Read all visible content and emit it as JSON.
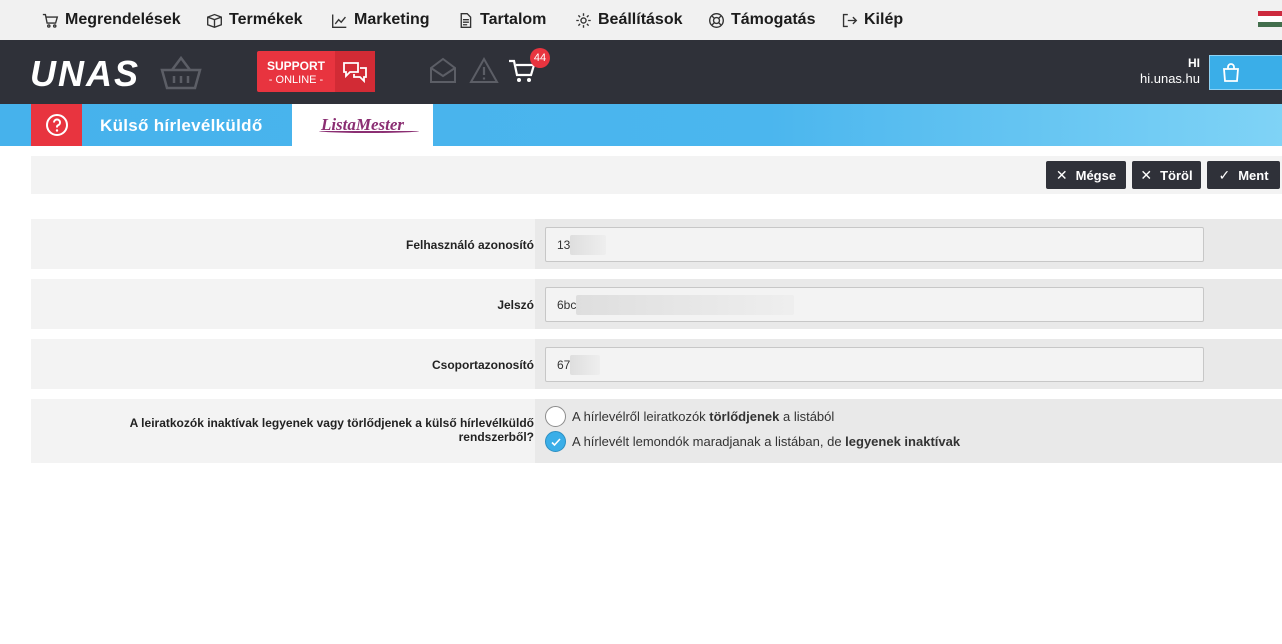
{
  "top_menu": {
    "items": [
      {
        "label": "Megrendelések",
        "icon": "cart-icon"
      },
      {
        "label": "Termékek",
        "icon": "box-icon"
      },
      {
        "label": "Marketing",
        "icon": "chart-icon"
      },
      {
        "label": "Tartalom",
        "icon": "document-icon"
      },
      {
        "label": "Beállítások",
        "icon": "gear-icon"
      },
      {
        "label": "Támogatás",
        "icon": "lifebuoy-icon"
      },
      {
        "label": "Kilép",
        "icon": "logout-icon"
      }
    ],
    "language_flag": "hungarian-flag-icon"
  },
  "header": {
    "logo": "UNAS",
    "support": {
      "line1": "SUPPORT",
      "line2": "- ONLINE -"
    },
    "cart_badge": "44",
    "user": {
      "name": "HI",
      "domain": "hi.unas.hu"
    }
  },
  "page": {
    "title": "Külső hírlevélküldő",
    "provider_logo": "ListaMester"
  },
  "actions": {
    "cancel": "Mégse",
    "delete": "Töröl",
    "save": "Ment"
  },
  "form": {
    "user_id": {
      "label": "Felhasználó azonosító",
      "value": "13"
    },
    "password": {
      "label": "Jelszó",
      "value": "6bc"
    },
    "group_id": {
      "label": "Csoportazonosító",
      "value": "67"
    },
    "unsubscribe": {
      "label_line1": "A leiratkozók inaktívak legyenek vagy törlődjenek a külső hírlevélküldő",
      "label_line2": "rendszerből?",
      "option1": {
        "pre": "A hírlevélről leiratkozók ",
        "bold": "törlődjenek",
        "post": " a listából",
        "selected": false
      },
      "option2": {
        "pre": "A hírlevélt lemondók maradjanak a listában, de ",
        "bold": "legyenek inaktívak",
        "post": "",
        "selected": true
      }
    }
  },
  "colors": {
    "header_bg": "#2f3139",
    "accent_red": "#e8343f",
    "accent_blue": "#3aaee8"
  }
}
